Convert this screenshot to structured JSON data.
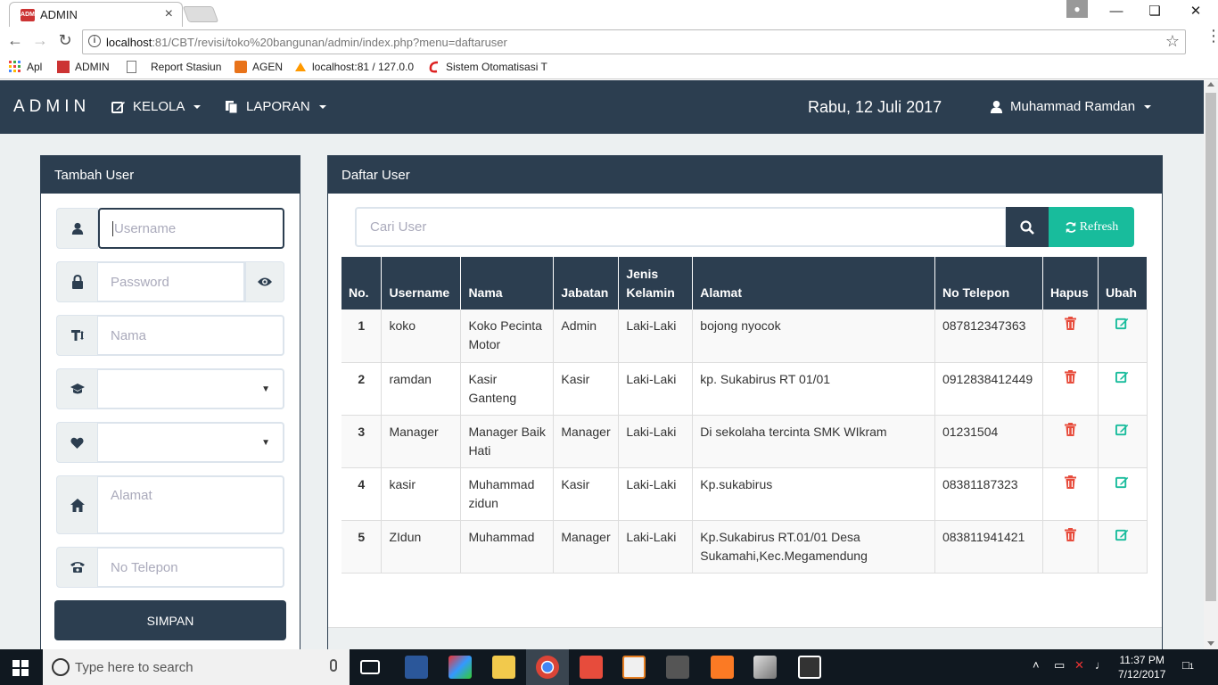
{
  "browser": {
    "tab_title": "ADMIN",
    "tab_close": "×",
    "url_host": "localhost",
    "url_rest": ":81/CBT/revisi/toko%20bangunan/admin/index.php?menu=daftaruser",
    "bookmarks": [
      "Apl",
      "ADMIN",
      "Report Stasiun",
      "AGEN",
      "localhost:81 / 127.0.0",
      "Sistem Otomatisasi T"
    ]
  },
  "app": {
    "brand": "ADMIN",
    "nav": {
      "kelola": "KELOLA",
      "laporan": "LAPORAN",
      "date": "Rabu, 12 Juli 2017",
      "user": "Muhammad Ramdan"
    }
  },
  "form": {
    "title": "Tambah User",
    "username_ph": "Username",
    "password_ph": "Password",
    "nama_ph": "Nama",
    "alamat_ph": "Alamat",
    "telepon_ph": "No Telepon",
    "submit": "SIMPAN"
  },
  "list": {
    "title": "Daftar User",
    "search_ph": "Cari User",
    "refresh": "Refresh",
    "headers": [
      "No.",
      "Username",
      "Nama",
      "Jabatan",
      "Jenis Kelamin",
      "Alamat",
      "No Telepon",
      "Hapus",
      "Ubah"
    ],
    "rows": [
      {
        "no": "1",
        "username": "koko",
        "nama": "Koko Pecinta Motor",
        "jabatan": "Admin",
        "jk": "Laki-Laki",
        "alamat": "bojong nyocok",
        "telp": "087812347363"
      },
      {
        "no": "2",
        "username": "ramdan",
        "nama": "Kasir Ganteng",
        "jabatan": "Kasir",
        "jk": "Laki-Laki",
        "alamat": "kp. Sukabirus RT 01/01",
        "telp": "0912838412449"
      },
      {
        "no": "3",
        "username": "Manager",
        "nama": "Manager Baik Hati",
        "jabatan": "Manager",
        "jk": "Laki-Laki",
        "alamat": "Di sekolaha tercinta SMK WIkram",
        "telp": "01231504"
      },
      {
        "no": "4",
        "username": "kasir",
        "nama": "Muhammad zidun",
        "jabatan": "Kasir",
        "jk": "Laki-Laki",
        "alamat": "Kp.sukabirus",
        "telp": "08381187323"
      },
      {
        "no": "5",
        "username": "ZIdun",
        "nama": "Muhammad",
        "jabatan": "Manager",
        "jk": "Laki-Laki",
        "alamat": "Kp.Sukabirus RT.01/01 Desa Sukamahi,Kec.Megamendung",
        "telp": "083811941421"
      }
    ]
  },
  "taskbar": {
    "search_ph": "Type here to search",
    "time": "11:37 PM",
    "date": "7/12/2017",
    "notif_count": "1"
  },
  "colors": {
    "primary": "#2c3e50",
    "success": "#18bc9c",
    "danger": "#e74c3c",
    "page_bg": "#ecf0f1"
  }
}
